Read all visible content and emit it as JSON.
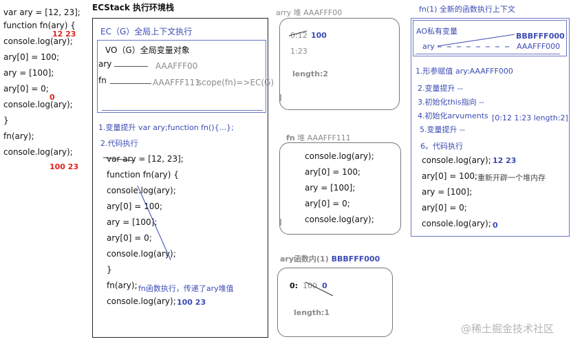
{
  "left_code": {
    "lines": [
      "var ary = [12, 23];",
      "function fn(ary) {",
      "console.log(ary);",
      "ary[0] = 100;",
      "ary = [100];",
      "ary[0] = 0;",
      "console.log(ary);",
      "}",
      "fn(ary);",
      "console.log(ary);"
    ],
    "note1": "12 23",
    "note2": "0",
    "note3": "100 23"
  },
  "ecstack": {
    "title": "ECStack 执行环境栈",
    "ec_label": "EC（G）全局上下文执行",
    "vo_label": "VO（G）全局变量对象",
    "vars": [
      {
        "name": "ary",
        "value": "AAAFFF00"
      },
      {
        "name": "fn",
        "value": "AAAFFF111",
        "scope": "scope(fn)=>EC(G)"
      }
    ],
    "step1": "1.变量提升 var ary;function fn(){...};",
    "step2": "2.代码执行",
    "code": [
      "var ary = [12, 23];",
      "function fn(ary) {",
      "console.log(ary);",
      "ary[0] = 100;",
      "ary = [100];",
      "ary[0] = 0;",
      "console.log(ary);",
      "}",
      "fn(ary);",
      "console.log(ary);"
    ],
    "fn_call_note": "fn函数执行，传递了ary堆值",
    "final_output": "100 23"
  },
  "heap_ary": {
    "title": "arry 堆 AAAFFF00",
    "entry0": "0:12",
    "entry0_new": "100",
    "entry1": "1:23",
    "length": "length:2"
  },
  "heap_fn": {
    "title_bold": "fn",
    "title_rest": "堆 AAAFFF111",
    "code": [
      "console.log(ary);",
      "ary[0] = 100;",
      "ary = [100];",
      "ary[0] = 0;",
      "console.log(ary);"
    ]
  },
  "heap_inner": {
    "title": "ary函数内(1)",
    "addr": "BBBFFF000",
    "entry0_label": "0:",
    "entry0_old": "100",
    "entry0_new": "0",
    "length": "length:1"
  },
  "fn_context": {
    "title": "fn(1) 全新的函数执行上下文",
    "ao_label": "AO私有变量",
    "ao_var": "ary",
    "ao_value_new": "BBBFFF000",
    "ao_value_old": "AAAFFF000",
    "steps": [
      "1.形参赋值  ary:AAAFFF000",
      "2.变量提升 --",
      "3.初始化this指向 --",
      "4.初始化arvuments",
      "5.变量提升 --",
      "6。代码执行"
    ],
    "arguments_value": "[0:12 1:23 length:2]",
    "code": [
      "console.log(ary);",
      "ary[0] = 100;",
      "ary = [100];",
      "ary[0] = 0;",
      "console.log(ary);"
    ],
    "out1": "12 23",
    "new_heap_note": "重新开辟一个堆内存",
    "out2": "0"
  },
  "watermark": "@稀土掘金技术社区"
}
